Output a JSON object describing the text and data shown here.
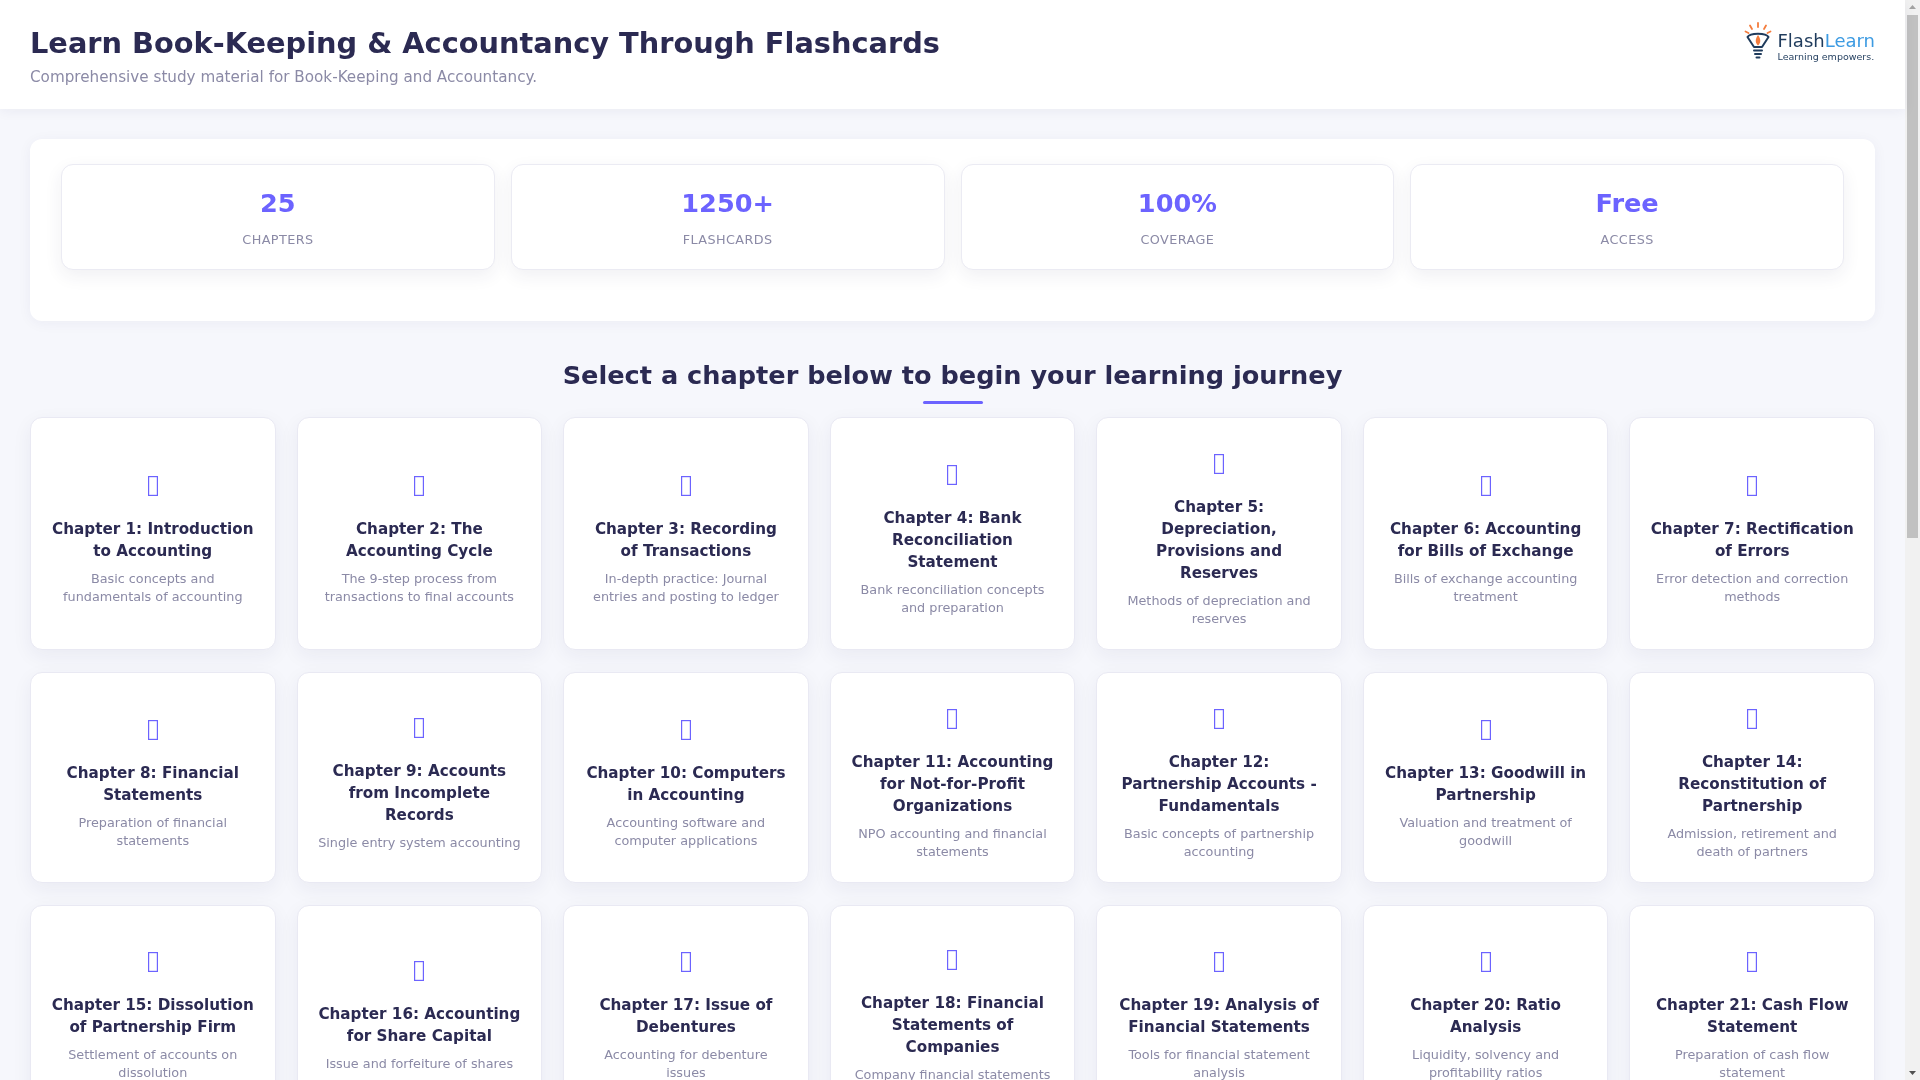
{
  "header": {
    "title": "Learn Book-Keeping & Accountancy Through Flashcards",
    "subtitle": "Comprehensive study material for Book-Keeping and Accountancy.",
    "logo": {
      "name_first": "Flash",
      "name_second": "Learn",
      "tagline": "Learning empowers."
    }
  },
  "stats": [
    {
      "value": "25",
      "label": "CHAPTERS"
    },
    {
      "value": "1250+",
      "label": "FLASHCARDS"
    },
    {
      "value": "100%",
      "label": "COVERAGE"
    },
    {
      "value": "Free",
      "label": "ACCESS"
    }
  ],
  "section_heading": "Select a chapter below to begin your learning journey",
  "chapters": [
    {
      "title": "Chapter 1: Introduction to Accounting",
      "description": "Basic concepts and fundamentals of accounting"
    },
    {
      "title": "Chapter 2: The Accounting Cycle",
      "description": "The 9-step process from transactions to final accounts"
    },
    {
      "title": "Chapter 3: Recording of Transactions",
      "description": "In-depth practice: Journal entries and posting to ledger"
    },
    {
      "title": "Chapter 4: Bank Reconciliation Statement",
      "description": "Bank reconciliation concepts and preparation"
    },
    {
      "title": "Chapter 5: Depreciation, Provisions and Reserves",
      "description": "Methods of depreciation and reserves"
    },
    {
      "title": "Chapter 6: Accounting for Bills of Exchange",
      "description": "Bills of exchange accounting treatment"
    },
    {
      "title": "Chapter 7: Rectification of Errors",
      "description": "Error detection and correction methods"
    },
    {
      "title": "Chapter 8: Financial Statements",
      "description": "Preparation of financial statements"
    },
    {
      "title": "Chapter 9: Accounts from Incomplete Records",
      "description": "Single entry system accounting"
    },
    {
      "title": "Chapter 10: Computers in Accounting",
      "description": "Accounting software and computer applications"
    },
    {
      "title": "Chapter 11: Accounting for Not-for-Profit Organizations",
      "description": "NPO accounting and financial statements"
    },
    {
      "title": "Chapter 12: Partnership Accounts - Fundamentals",
      "description": "Basic concepts of partnership accounting"
    },
    {
      "title": "Chapter 13: Goodwill in Partnership",
      "description": "Valuation and treatment of goodwill"
    },
    {
      "title": "Chapter 14: Reconstitution of Partnership",
      "description": "Admission, retirement and death of partners"
    },
    {
      "title": "Chapter 15: Dissolution of Partnership Firm",
      "description": "Settlement of accounts on dissolution"
    },
    {
      "title": "Chapter 16: Accounting for Share Capital",
      "description": "Issue and forfeiture of shares"
    },
    {
      "title": "Chapter 17: Issue of Debentures",
      "description": "Accounting for debenture issues"
    },
    {
      "title": "Chapter 18: Financial Statements of Companies",
      "description": "Company financial statements"
    },
    {
      "title": "Chapter 19: Analysis of Financial Statements",
      "description": "Tools for financial statement analysis"
    },
    {
      "title": "Chapter 20: Ratio Analysis",
      "description": "Liquidity, solvency and profitability ratios"
    },
    {
      "title": "Chapter 21: Cash Flow Statement",
      "description": "Preparation of cash flow statement"
    }
  ]
}
